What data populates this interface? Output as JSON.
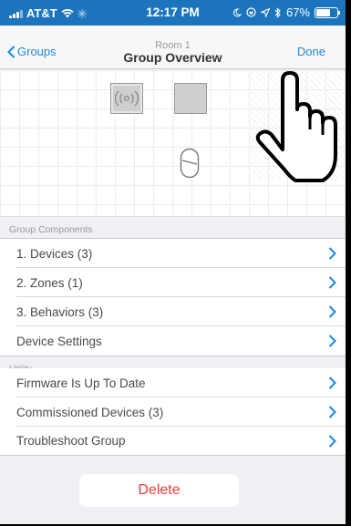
{
  "status_bar": {
    "carrier": "AT&T",
    "time": "12:17 PM",
    "battery": "67%",
    "battery_level": 0.67,
    "accent_color": "#1c75bc"
  },
  "nav": {
    "back_label": "Groups",
    "subtitle": "Room 1",
    "title": "Group Overview",
    "done_label": "Done"
  },
  "canvas": {
    "device_icons": [
      "wireless-device-icon",
      "square-device-icon",
      "sensor-icon"
    ],
    "overlay": "pointing-hand-icon"
  },
  "sections": [
    {
      "header": "Group Components",
      "items": [
        {
          "label": "1. Devices (3)"
        },
        {
          "label": "2. Zones (1)"
        },
        {
          "label": "3. Behaviors (3)"
        },
        {
          "label": "Device Settings"
        }
      ]
    },
    {
      "header": "Utility",
      "items": [
        {
          "label": "Firmware Is Up To Date"
        },
        {
          "label": "Commissioned Devices (3)"
        },
        {
          "label": "Troubleshoot Group"
        }
      ]
    }
  ],
  "delete_label": "Delete",
  "colors": {
    "link": "#1c88e0",
    "destructive": "#ee3b3b",
    "chevron": "#1c88e0"
  }
}
